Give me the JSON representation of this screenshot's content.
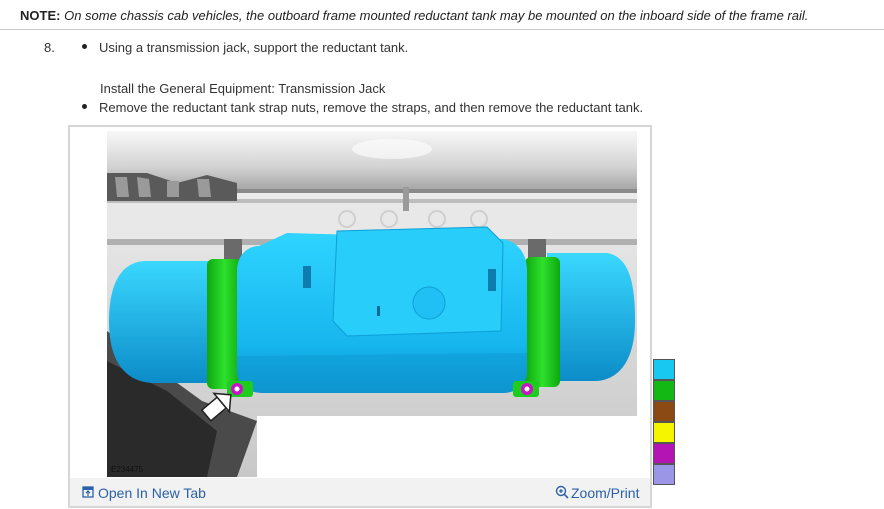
{
  "note": {
    "label": "NOTE:",
    "text": "On some chassis cab vehicles, the outboard frame mounted reductant tank may be mounted on the inboard side of the frame rail."
  },
  "step": {
    "number": "8.",
    "bullet_1": "Using a transmission jack, support the reductant tank.",
    "equipment_line": "Install the General Equipment: Transmission Jack",
    "bullet_2": "Remove the reductant tank strap nuts, remove the straps, and then remove the reductant tank."
  },
  "figure": {
    "image_id": "E234475",
    "open_label": "Open In New Tab",
    "zoom_label": "Zoom/Print",
    "open_icon": "open-new-tab-icon",
    "zoom_icon": "zoom-in-icon"
  },
  "legend_colors": [
    "#19c8f0",
    "#14b814",
    "#8b4a14",
    "#f5f500",
    "#b414b4",
    "#9b96e6"
  ],
  "colors": {
    "tank": "#1ec8ff",
    "strap": "#1ecc1e",
    "nut": "#c814c8",
    "link": "#2a61a8"
  }
}
